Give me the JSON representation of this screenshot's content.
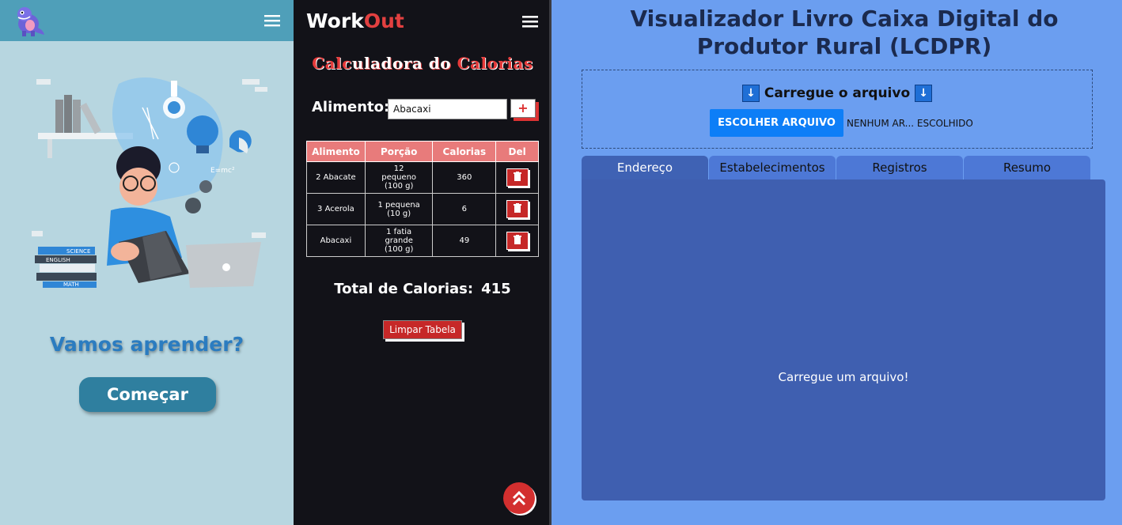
{
  "learn_app": {
    "headline": "Vamos aprender?",
    "start_label": "Começar",
    "book_labels": [
      "SCIENCE",
      "ENGLISH",
      "MATH"
    ],
    "formula": "E=mc²",
    "colors": {
      "header": "#4f9fb9",
      "background": "#b7d6e0",
      "button": "#2f7f9f",
      "headline": "#2b7cc0"
    },
    "icons": [
      "dinosaur-logo-icon",
      "hamburger-menu-icon"
    ]
  },
  "workout": {
    "brand_main": "Work",
    "brand_accent": "Out",
    "title_parts": [
      "Calc",
      "uladora do ",
      "Calorias"
    ],
    "food_label": "Alimento:",
    "food_value": "Abacaxi",
    "add_label": "+",
    "table": {
      "headers": [
        "Alimento",
        "Porção",
        "Calorias",
        "Del"
      ],
      "rows": [
        {
          "food": "2 Abacate",
          "portion": [
            "12",
            "pequeno",
            "(100 g)"
          ],
          "calories": "360"
        },
        {
          "food": "3 Acerola",
          "portion": [
            "1 pequena",
            "(10 g)"
          ],
          "calories": "6"
        },
        {
          "food": "Abacaxi",
          "portion": [
            "1 fatia",
            "grande",
            "(100 g)"
          ],
          "calories": "49"
        }
      ]
    },
    "total_label": "Total de Calorias:",
    "total_value": "415",
    "clear_label": "Limpar Tabela",
    "colors": {
      "background": "#121218",
      "accent": "#e24040",
      "table_header": "#e87b7b",
      "button": "#c62828"
    },
    "icons": [
      "hamburger-menu-icon",
      "trash-icon",
      "double-chevron-up-icon"
    ]
  },
  "lcdpr": {
    "title_line1": "Visualizador Livro Caixa Digital do",
    "title_line2": "Produtor Rural (LCDPR)",
    "upload_arrow": "↓",
    "upload_title": "Carregue o arquivo",
    "choose_label": "ESCOLHER ARQUIVO",
    "file_status": "NENHUM AR... ESCOLHIDO",
    "tabs": [
      "Endereço",
      "Estabelecimentos",
      "Registros",
      "Resumo"
    ],
    "active_tab": "Endereço",
    "empty_message": "Carregue um arquivo!",
    "colors": {
      "background": "#6b9ef0",
      "panel": "#3f5fb0",
      "tab": "#4d78d6",
      "button": "#0d7ef7",
      "title": "#1b2a4e"
    },
    "icons": [
      "down-arrow-icon"
    ]
  }
}
